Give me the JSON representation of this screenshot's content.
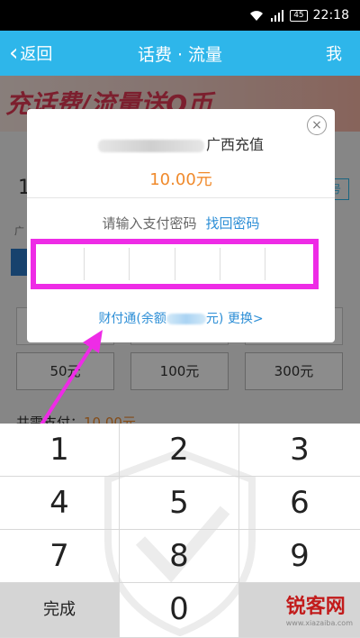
{
  "statusbar": {
    "battery": "45",
    "time": "22:18"
  },
  "header": {
    "back_label": "返回",
    "title": "话费 · 流量",
    "me_label": "我"
  },
  "banner": {
    "text": "充话费/流量送Q币"
  },
  "background": {
    "phone_partial": "1",
    "contact_partial": "号",
    "label_partial": "广",
    "amounts": [
      "50元",
      "100元",
      "300元"
    ],
    "total_label": "共需支付：",
    "total_value": "10.00元"
  },
  "dialog": {
    "close_icon": "×",
    "merchant": "广西充值",
    "amount": "10.00元",
    "prompt": "请输入支付密码",
    "forgot": "找回密码",
    "pay_method_prefix": "财付通(余额",
    "pay_method_suffix": "元)",
    "change": "更换>",
    "password_cells": 6
  },
  "keypad": {
    "keys": [
      "1",
      "2",
      "3",
      "4",
      "5",
      "6",
      "7",
      "8",
      "9"
    ],
    "done": "完成",
    "zero": "0"
  },
  "watermark": {
    "text": "锐客网",
    "url": "www.xiazaiba.com"
  },
  "colors": {
    "header": "#2eb6ea",
    "highlight": "#ee2be6",
    "link": "#2c8ed6",
    "amount": "#f08a2c"
  }
}
